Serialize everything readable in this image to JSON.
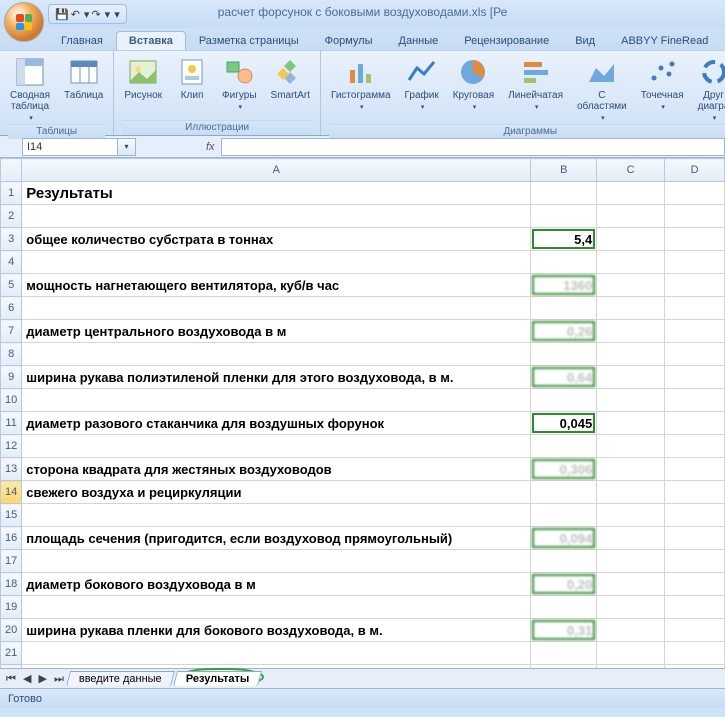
{
  "title": "расчет форсунок с боковыми воздуховодами.xls  [Ре",
  "qat": {
    "save": "💾",
    "undo": "↶",
    "redo": "↷"
  },
  "tabs": {
    "home": "Главная",
    "insert": "Вставка",
    "layout": "Разметка страницы",
    "formulas": "Формулы",
    "data": "Данные",
    "review": "Рецензирование",
    "view": "Вид",
    "abbyy": "ABBYY FineRead"
  },
  "ribbon": {
    "tables": {
      "pivot": "Сводная таблица",
      "table": "Таблица",
      "group": "Таблицы"
    },
    "illustrations": {
      "picture": "Рисунок",
      "clip": "Клип",
      "shapes": "Фигуры",
      "smartart": "SmartArt",
      "group": "Иллюстрации"
    },
    "charts": {
      "column": "Гистограмма",
      "line": "График",
      "pie": "Круговая",
      "bar": "Линейчатая",
      "area": "С областями",
      "scatter": "Точечная",
      "other": "Друг диагра",
      "group": "Диаграммы"
    }
  },
  "namebox": "I14",
  "fx_label": "fx",
  "columns": {
    "A": "A",
    "B": "B",
    "C": "C",
    "D": "D"
  },
  "rows": {
    "r1": {
      "a": "Результаты"
    },
    "r3": {
      "a": "общее количество субстрата в тоннах",
      "b": "5,4"
    },
    "r5": {
      "a": "мощность нагнетающего вентилятора, куб/в час",
      "b": "1360"
    },
    "r7": {
      "a": "диаметр центрального воздуховода в м",
      "b": "0,26"
    },
    "r9": {
      "a": "ширина рукава полиэтиленой пленки для этого воздуховода, в м.",
      "b": "0,64"
    },
    "r11": {
      "a": "диаметр разового стаканчика для воздушных форунок",
      "b": "0,045"
    },
    "r13": {
      "a": "сторона квадрата для жестяных воздуховодов",
      "b": "0,306"
    },
    "r14": {
      "a": "свежего воздуха и рециркуляции"
    },
    "r16": {
      "a": "площадь сечения (пригодится, если воздуховод прямоугольный)",
      "b": "0,094"
    },
    "r18": {
      "a": "диаметр бокового воздуховода в м",
      "b": "0,20"
    },
    "r20": {
      "a": "ширина рукава пленки для бокового воздуховода, в м.",
      "b": "0,31"
    }
  },
  "sheet_tabs": {
    "t1": "введите данные",
    "t2": "Результаты"
  },
  "status": "Готово"
}
